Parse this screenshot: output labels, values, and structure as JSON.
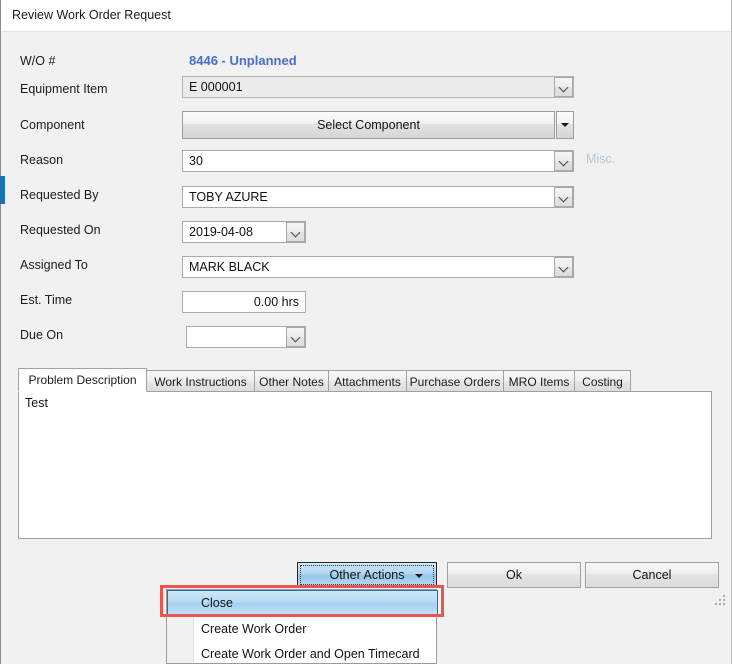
{
  "window": {
    "title": "Review Work Order Request"
  },
  "form": {
    "wo_number": {
      "label": "W/O #",
      "value": "8446 - Unplanned",
      "color": "#4a6fc4"
    },
    "equipment_item": {
      "label": "Equipment Item",
      "value": "E 000001"
    },
    "component": {
      "label": "Component",
      "button_label": "Select Component"
    },
    "reason": {
      "label": "Reason",
      "value": "30",
      "note": "Misc."
    },
    "requested_by": {
      "label": "Requested By",
      "value": "TOBY AZURE"
    },
    "requested_on": {
      "label": "Requested On",
      "value": "2019-04-08"
    },
    "assigned_to": {
      "label": "Assigned To",
      "value": "MARK BLACK"
    },
    "est_time": {
      "label": "Est. Time",
      "value": "0.00 hrs"
    },
    "due_on": {
      "label": "Due On",
      "value": ""
    }
  },
  "tabs": [
    {
      "label": "Problem Description",
      "active": true
    },
    {
      "label": "Work Instructions",
      "active": false
    },
    {
      "label": "Other Notes",
      "active": false
    },
    {
      "label": "Attachments",
      "active": false
    },
    {
      "label": "Purchase Orders",
      "active": false
    },
    {
      "label": "MRO Items",
      "active": false
    },
    {
      "label": "Costing",
      "active": false
    }
  ],
  "description": {
    "value": "Test"
  },
  "footer": {
    "other_actions_label": "Other Actions",
    "ok_label": "Ok",
    "cancel_label": "Cancel"
  },
  "dropdown_menu": {
    "items": [
      {
        "label": "Close",
        "highlighted": true
      },
      {
        "label": "Create Work Order",
        "highlighted": false
      },
      {
        "label": "Create Work Order and Open Timecard",
        "highlighted": false
      }
    ],
    "highlight_color": "#e8564e"
  }
}
